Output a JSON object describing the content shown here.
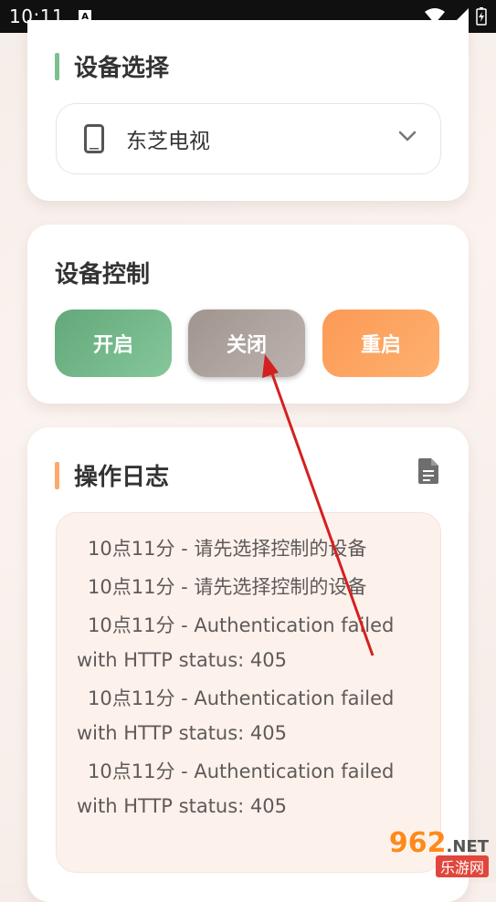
{
  "status_bar": {
    "time": "10:11",
    "app_glyph": "A"
  },
  "device_select": {
    "title": "设备选择",
    "selected": "东芝电视",
    "accent_color": "#7cc08f"
  },
  "device_control": {
    "title": "设备控制",
    "buttons": {
      "on": "开启",
      "off": "关闭",
      "restart": "重启"
    },
    "colors": {
      "on": "#6db184",
      "off": "#aa9f9a",
      "restart": "#fda060"
    }
  },
  "operation_log": {
    "title": "操作日志",
    "accent_color": "#fba96a",
    "entries": [
      "10点11分 - 请先选择控制的设备",
      "10点11分 - 请先选择控制的设备",
      "10点11分 - Authentication failed with HTTP status: 405",
      "10点11分 - Authentication failed with HTTP status: 405",
      "10点11分 - Authentication failed with HTTP status: 405"
    ]
  },
  "watermark": {
    "number": "962",
    "suffix": ".NET",
    "name": "乐游网"
  }
}
